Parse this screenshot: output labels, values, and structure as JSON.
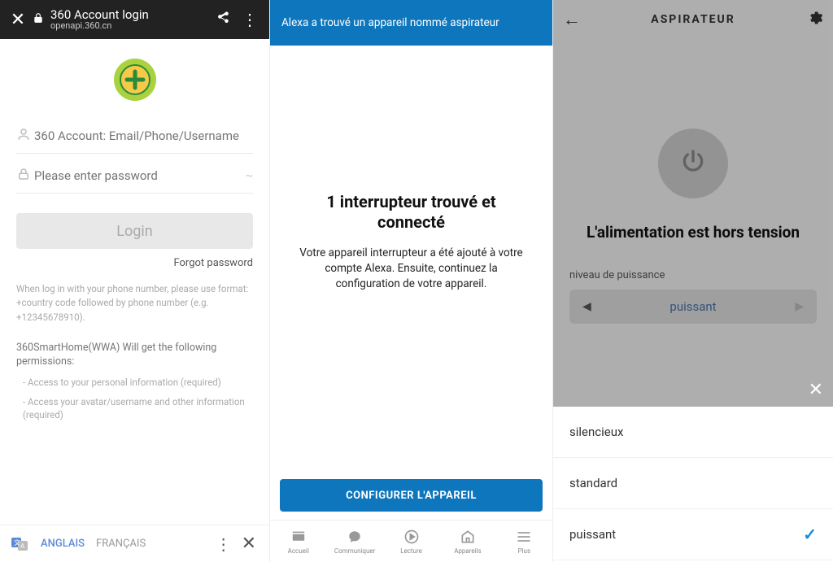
{
  "panel1": {
    "header_title": "360 Account login",
    "header_url": "openapi.360.cn",
    "account_placeholder": "360 Account: Email/Phone/Username",
    "password_placeholder": "Please enter password",
    "login_label": "Login",
    "forgot_label": "Forgot password",
    "help_text": "When log in with your phone number, please use format: +country code followed by phone number (e.g. +12345678910).",
    "perm_title": "360SmartHome(WWA) Will get the following permissions:",
    "perm1": "- Access to your personal information (required)",
    "perm2": "- Access your avatar/username and other information (required)",
    "lang1": "ANGLAIS",
    "lang2": "FRANÇAIS"
  },
  "panel2": {
    "banner": "Alexa a trouvé un appareil nommé aspirateur",
    "title": "1 interrupteur trouvé et connecté",
    "desc": "Votre appareil interrupteur a été ajouté à votre compte Alexa. Ensuite, continuez la configuration de votre appareil.",
    "button": "CONFIGURER L'APPAREIL",
    "nav": [
      "Accueil",
      "Communiquer",
      "Lecture",
      "Appareils",
      "Plus"
    ]
  },
  "panel3": {
    "title": "ASPIRATEUR",
    "status": "L'alimentation est hors tension",
    "level_label": "niveau de puissance",
    "selected": "puissant",
    "options": [
      "silencieux",
      "standard",
      "puissant"
    ],
    "checked_index": 2
  }
}
